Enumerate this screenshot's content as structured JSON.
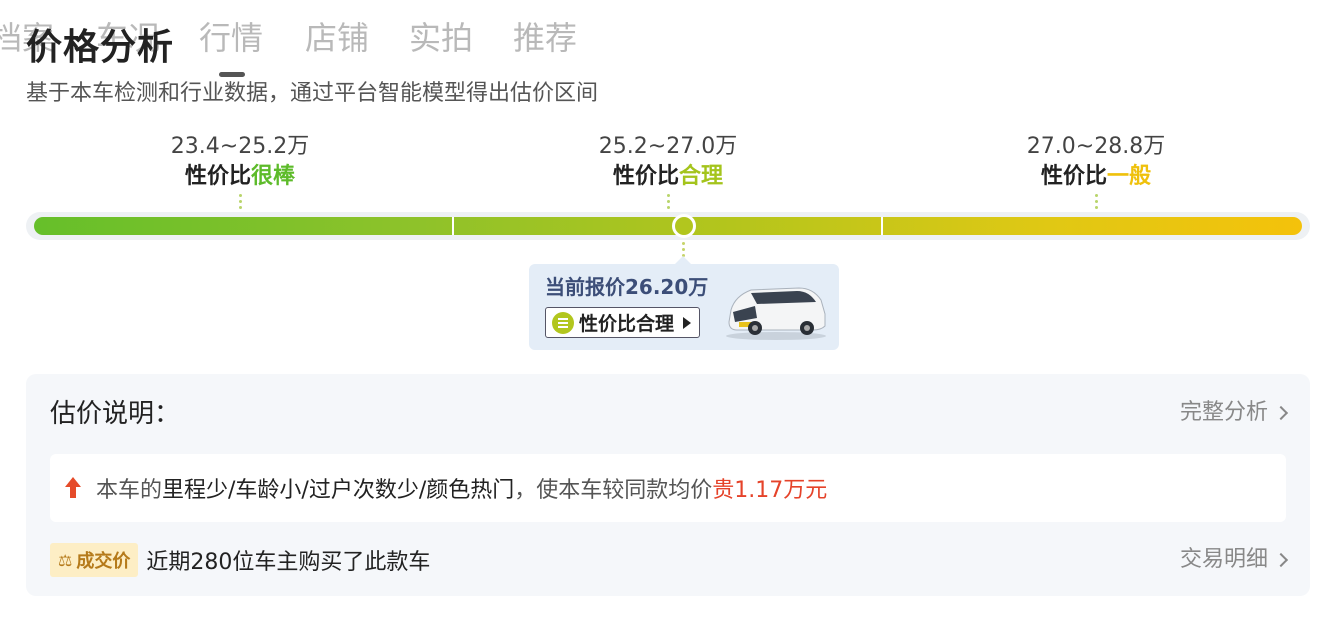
{
  "tabs": [
    {
      "label": "档案"
    },
    {
      "label": "车况"
    },
    {
      "label": "行情"
    },
    {
      "label": "店铺"
    },
    {
      "label": "实拍"
    },
    {
      "label": "推荐"
    }
  ],
  "active_tab": "行情",
  "section": {
    "title": "价格分析",
    "subtitle": "基于本车检测和行业数据，通过平台智能模型得出估价区间"
  },
  "segments": [
    {
      "range": "23.4~25.2万",
      "label_prefix": "性价比",
      "label_rating": "很棒",
      "color": "#5dbb2a"
    },
    {
      "range": "25.2~27.0万",
      "label_prefix": "性价比",
      "label_rating": "合理",
      "color": "#a4c41c"
    },
    {
      "range": "27.0~28.8万",
      "label_prefix": "性价比",
      "label_rating": "一般",
      "color": "#efc10c"
    }
  ],
  "current_price": {
    "text": "当前报价26.20万",
    "value_wan": 26.2,
    "tag": "性价比合理",
    "scale_min_wan": 23.4,
    "scale_max_wan": 28.8
  },
  "explanation": {
    "title": "估价说明：",
    "link_label": "完整分析",
    "reason_prefix": "本车的",
    "reason_factors": "里程少/车龄小/过户次数少/颜色热门",
    "reason_mid": "，使本车较同款均价",
    "reason_delta": "贵1.17万元",
    "deal_badge": "成交价",
    "deal_text": "近期280位车主购买了此款车",
    "deal_link": "交易明细"
  },
  "colors": {
    "accent_green": "#5dbb2a",
    "accent_yellow_green": "#a4c41c",
    "accent_yellow": "#efc10c",
    "price_up_red": "#e5432a",
    "bubble_bg": "#e4edf7"
  },
  "icons": [
    "up-arrow-icon",
    "chevron-right-icon",
    "equal-icon",
    "play-arrow-icon",
    "deal-price-icon"
  ]
}
